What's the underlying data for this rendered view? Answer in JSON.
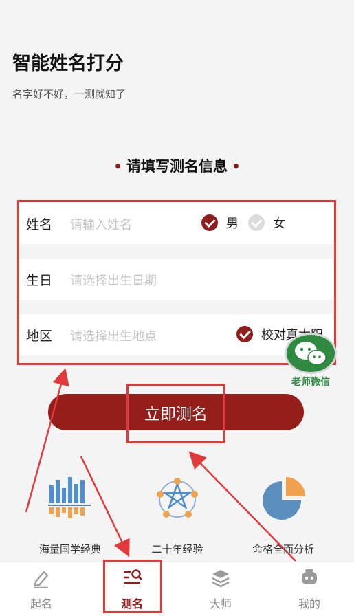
{
  "header": {
    "title": "智能姓名打分",
    "subtitle": "名字好不好，一测就知了"
  },
  "form": {
    "section_title": "请填写测名信息",
    "name": {
      "label": "姓名",
      "placeholder": "请输入姓名"
    },
    "gender": {
      "male": "男",
      "female": "女",
      "selected": "男"
    },
    "birthday": {
      "label": "生日",
      "placeholder": "请选择出生日期"
    },
    "region": {
      "label": "地区",
      "placeholder": "请选择出生地点",
      "calibrate_label": "校对真太阳",
      "calibrate_checked": true
    },
    "submit_label": "立即测名"
  },
  "wechat_float": {
    "label": "老师微信"
  },
  "features": [
    {
      "label": "海量国学经典",
      "icon": "bar-chart-icon"
    },
    {
      "label": "二十年经验",
      "icon": "pentagram-network-icon"
    },
    {
      "label": "命格全面分析",
      "icon": "pie-chart-icon"
    }
  ],
  "tabbar": [
    {
      "label": "起名",
      "icon": "pen-icon",
      "active": false
    },
    {
      "label": "测名",
      "icon": "search-list-icon",
      "active": true
    },
    {
      "label": "大师",
      "icon": "layers-icon",
      "active": false
    },
    {
      "label": "我的",
      "icon": "robot-face-icon",
      "active": false
    }
  ],
  "colors": {
    "brand": "#951e1a",
    "annotation": "#e23a3a",
    "wechat": "#2d8a40",
    "background": "#f4f4f4"
  }
}
